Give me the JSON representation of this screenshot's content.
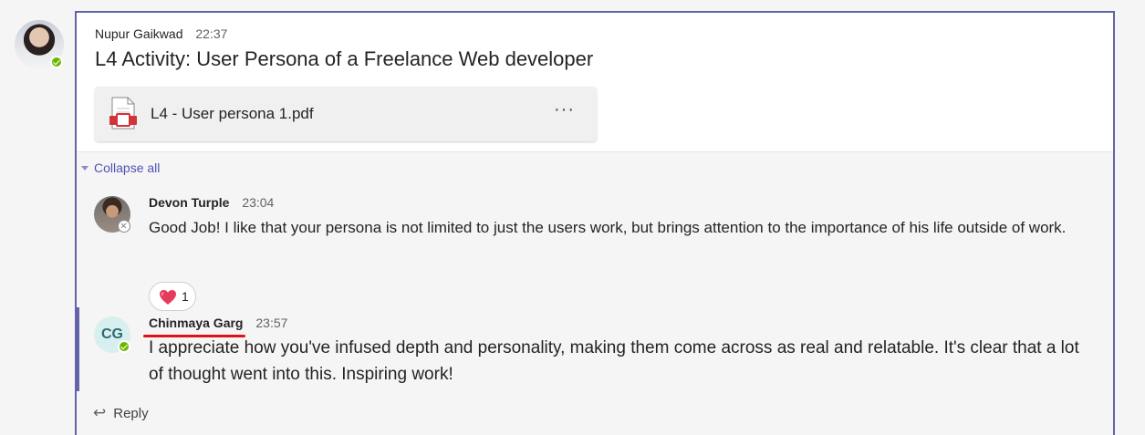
{
  "post": {
    "author": "Nupur Gaikwad",
    "time": "22:37",
    "title": "L4 Activity: User Persona of a Freelance Web developer",
    "attachment": {
      "name": "L4 - User persona 1.pdf",
      "more_label": "···"
    }
  },
  "thread": {
    "collapse_label": "Collapse all",
    "replies": [
      {
        "author": "Devon Turple",
        "time": "23:04",
        "text": "Good Job! I like that your persona is not limited to just the users work, but brings attention to the importance of his life outside of work.",
        "reaction": {
          "icon": "heart-icon",
          "count": "1"
        }
      },
      {
        "author": "Chinmaya Garg",
        "initials": "CG",
        "time": "23:57",
        "text": "I appreciate how you've infused depth and personality, making them come across as real and relatable. It's clear that a lot of thought went into this. Inspiring work!"
      }
    ],
    "reply_label": "Reply"
  },
  "colors": {
    "accent": "#6264a7",
    "link": "#4f52b2",
    "available": "#6bb700",
    "underline": "#e30f16"
  }
}
